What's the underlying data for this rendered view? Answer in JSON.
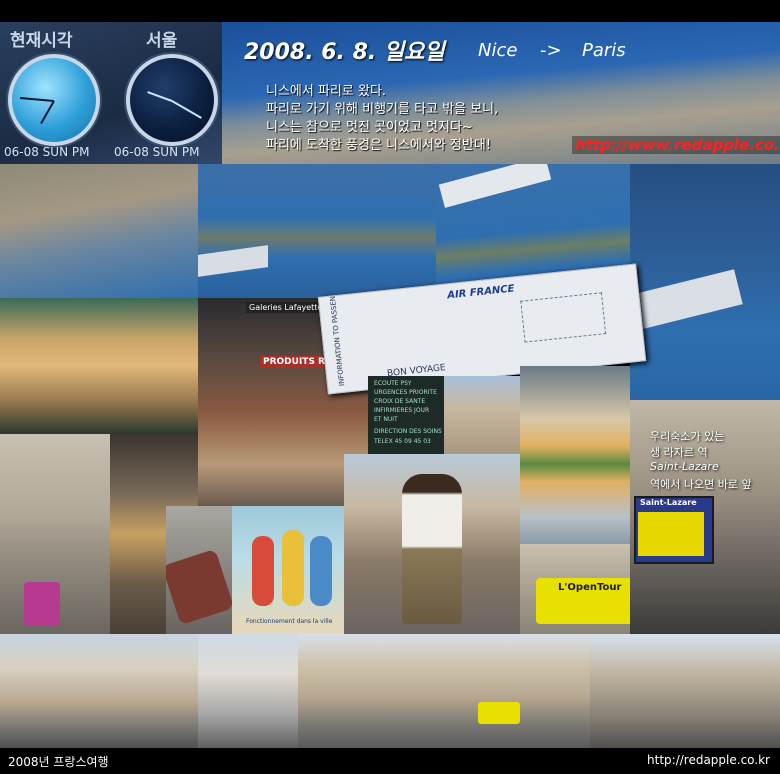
{
  "clocks": {
    "label_left": "현재시각",
    "label_right": "서울",
    "date_left": "06-08 SUN PM",
    "date_right": "06-08 SUN PM"
  },
  "header": {
    "date": "2008. 6. 8. 일요일",
    "from": "Nice",
    "arrow": "->",
    "to": "Paris",
    "lines": [
      "니스에서 파리로 왔다.",
      "파리로 가기 위해 비행기를 타고 밖을 보니,",
      "니스는 참으로 멋진 곳이었고 멋지다~",
      "파리에 도착한 풍경은 니스에서와 정반대!"
    ],
    "url": "http://www.redapple.co.kr"
  },
  "ticket": {
    "airline": "AIR FRANCE",
    "info": "INFORMATION TO PASSENGERS",
    "bon": "BON VOYAGE"
  },
  "pharmacy": {
    "l1": "ECOUTE PSY",
    "l2": "URGENCES PRIORITE",
    "l3": "CROIX DE SANTE",
    "l4": "INFIRMIERES JOUR",
    "l5": "ET NUIT",
    "l6": "DIRECTION DES SOINS",
    "l7": "TELEX 45 09 45 03"
  },
  "shop_sign": "PRODUITS REGIONAUX",
  "cafe_sign": "Galeries Lafayette",
  "bus_label": "L'OpenTour",
  "station": {
    "note_line1": "우리숙소가 있는",
    "note_line2": "생 라자르 역",
    "note_line3": "Saint-Lazare",
    "note_line4": "역에서 나오면 바로 앞",
    "sign": "Saint-Lazare"
  },
  "poster_caption": "Fonctionnement dans la ville",
  "footer": {
    "left": "2008년 프랑스여행",
    "right": "http://redapple.co.kr"
  },
  "colors": {
    "sea": "#2e6fb0",
    "url_red": "#ff2020",
    "bus_yellow": "#e8e000",
    "note_white": "#ffffff"
  }
}
